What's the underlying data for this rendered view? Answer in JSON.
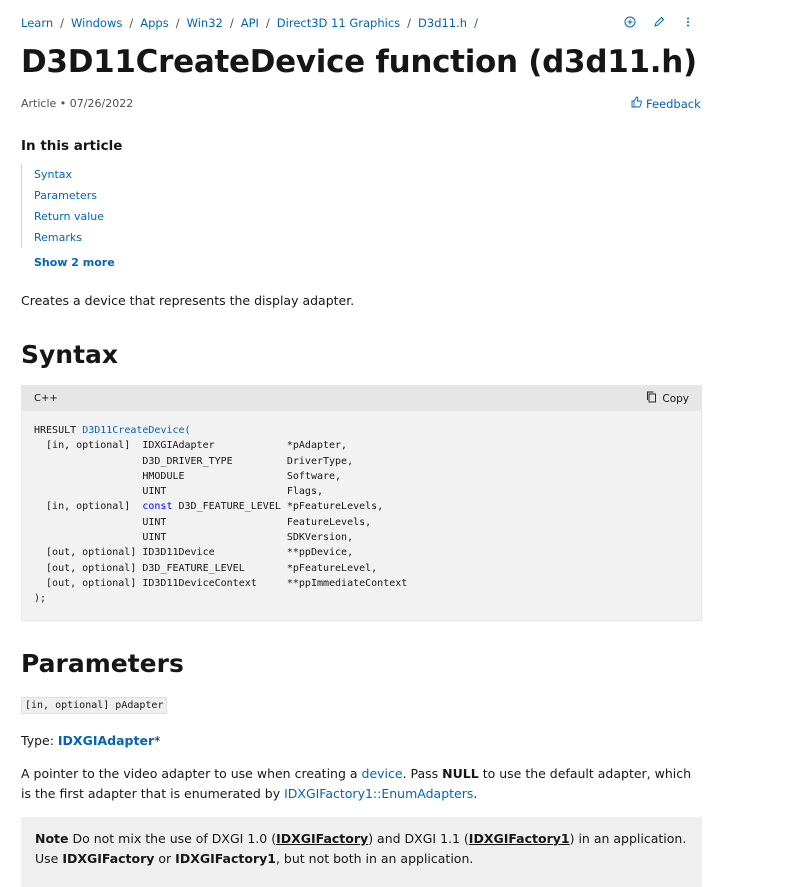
{
  "breadcrumb": [
    "Learn",
    "Windows",
    "Apps",
    "Win32",
    "API",
    "Direct3D 11 Graphics",
    "D3d11.h"
  ],
  "breadcrumb_sep": "/",
  "title": "D3D11CreateDevice function (d3d11.h)",
  "meta": {
    "type": "Article",
    "date": "07/26/2022"
  },
  "feedback_label": "Feedback",
  "toc": {
    "title": "In this article",
    "items": [
      "Syntax",
      "Parameters",
      "Return value",
      "Remarks"
    ],
    "show_more": "Show 2 more"
  },
  "lead": "Creates a device that represents the display adapter.",
  "syntax": {
    "heading": "Syntax",
    "language": "C++",
    "copy_label": "Copy",
    "code_return_type": "HRESULT",
    "code_function": "D3D11CreateDevice(",
    "code_lines": [
      [
        "  [in, optional]  ",
        "",
        "IDXGIAdapter            ",
        "*pAdapter,"
      ],
      [
        "                  ",
        "",
        "D3D_DRIVER_TYPE         ",
        "DriverType,"
      ],
      [
        "                  ",
        "",
        "HMODULE                 ",
        "Software,"
      ],
      [
        "                  ",
        "",
        "UINT                    ",
        "Flags,"
      ],
      [
        "  [in, optional]  ",
        "const",
        " D3D_FEATURE_LEVEL ",
        "*pFeatureLevels,"
      ],
      [
        "                  ",
        "",
        "UINT                    ",
        "FeatureLevels,"
      ],
      [
        "                  ",
        "",
        "UINT                    ",
        "SDKVersion,"
      ],
      [
        "  [out, optional] ",
        "",
        "ID3D11Device            ",
        "**ppDevice,"
      ],
      [
        "  [out, optional] ",
        "",
        "D3D_FEATURE_LEVEL       ",
        "*pFeatureLevel,"
      ],
      [
        "  [out, optional] ",
        "",
        "ID3D11DeviceContext     ",
        "**ppImmediateContext"
      ]
    ],
    "code_end": ");"
  },
  "parameters": {
    "heading": "Parameters",
    "param_tag": "[in, optional] pAdapter",
    "type_prefix": "Type: ",
    "type_link": "IDXGIAdapter",
    "type_suffix": "*",
    "desc_1": "A pointer to the video adapter to use when creating a ",
    "desc_link_1": "device",
    "desc_2": ". Pass ",
    "desc_bold": "NULL",
    "desc_3": " to use the default adapter, which is the first adapter that is enumerated by ",
    "desc_link_2": "IDXGIFactory1::EnumAdapters",
    "desc_4": ".",
    "note": {
      "label": "Note",
      "t1": "  Do not mix the use of DXGI 1.0 (",
      "l1": "IDXGIFactory",
      "t2": ") and DXGI 1.1 (",
      "l2": "IDXGIFactory1",
      "t3": ") in an application. Use ",
      "b1": "IDXGIFactory",
      "t4": " or ",
      "b2": "IDXGIFactory1",
      "t5": ", but not both in an application."
    }
  },
  "icons": {
    "add": "circle-plus-icon",
    "edit": "pencil-icon",
    "more": "vertical-ellipsis-icon",
    "feedback": "thumbs-icon",
    "copy": "copy-icon"
  },
  "colors": {
    "link": "#0065b3",
    "text": "#161616",
    "code_bg": "#f2f2f2",
    "code_head_bg": "#e6e6e6",
    "keyword": "#0101fd"
  }
}
